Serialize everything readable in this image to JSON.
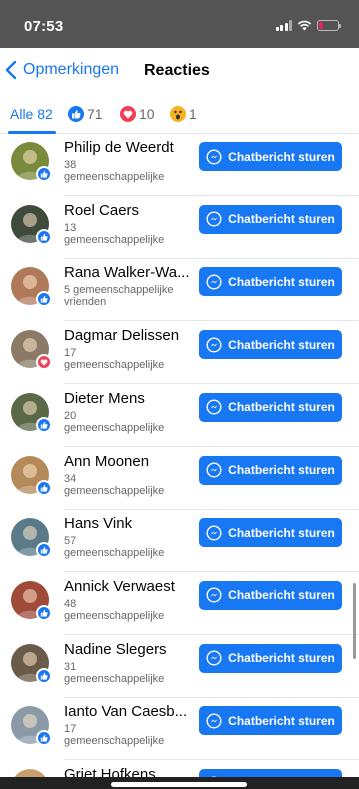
{
  "status": {
    "time": "07:53"
  },
  "nav": {
    "back_label": "Opmerkingen",
    "title": "Reacties"
  },
  "tabs": {
    "all": "Alle 82",
    "like_count": "71",
    "love_count": "10",
    "wow_count": "1"
  },
  "button_label": "Chatbericht sturen",
  "people": [
    {
      "name": "Philip de Weerdt",
      "mutual_1": "38",
      "mutual_2": "gemeenschappelijke",
      "reaction": "like",
      "avatar_color": "#7a8a3c"
    },
    {
      "name": "Roel Caers",
      "mutual_1": "13",
      "mutual_2": "gemeenschappelijke",
      "reaction": "like",
      "avatar_color": "#3e4a3a"
    },
    {
      "name": "Rana Walker-Wa...",
      "mutual_1": "5 gemeenschappelijke",
      "mutual_2": "vrienden",
      "reaction": "like",
      "avatar_color": "#b07a5a"
    },
    {
      "name": "Dagmar Delissen",
      "mutual_1": "17",
      "mutual_2": "gemeenschappelijke",
      "reaction": "love",
      "avatar_color": "#8a7a66"
    },
    {
      "name": "Dieter Mens",
      "mutual_1": "20",
      "mutual_2": "gemeenschappelijke",
      "reaction": "like",
      "avatar_color": "#5a6a48"
    },
    {
      "name": "Ann Moonen",
      "mutual_1": "34",
      "mutual_2": "gemeenschappelijke",
      "reaction": "like",
      "avatar_color": "#b58a5a"
    },
    {
      "name": "Hans Vink",
      "mutual_1": "57",
      "mutual_2": "gemeenschappelijke",
      "reaction": "like",
      "avatar_color": "#5a7a8a"
    },
    {
      "name": "Annick Verwaest",
      "mutual_1": "48",
      "mutual_2": "gemeenschappelijke",
      "reaction": "like",
      "avatar_color": "#a04a3a"
    },
    {
      "name": "Nadine Slegers",
      "mutual_1": "31",
      "mutual_2": "gemeenschappelijke",
      "reaction": "like",
      "avatar_color": "#6a5a4a"
    },
    {
      "name": "Ianto Van Caesb...",
      "mutual_1": "17",
      "mutual_2": "gemeenschappelijke",
      "reaction": "like",
      "avatar_color": "#8a9aa8"
    },
    {
      "name": "Griet Hofkens",
      "mutual_1": "",
      "mutual_2": "",
      "reaction": "like",
      "avatar_color": "#c8a070"
    }
  ],
  "colors": {
    "accent": "#1877f2",
    "love": "#f33e58",
    "wow": "#f7b125"
  }
}
